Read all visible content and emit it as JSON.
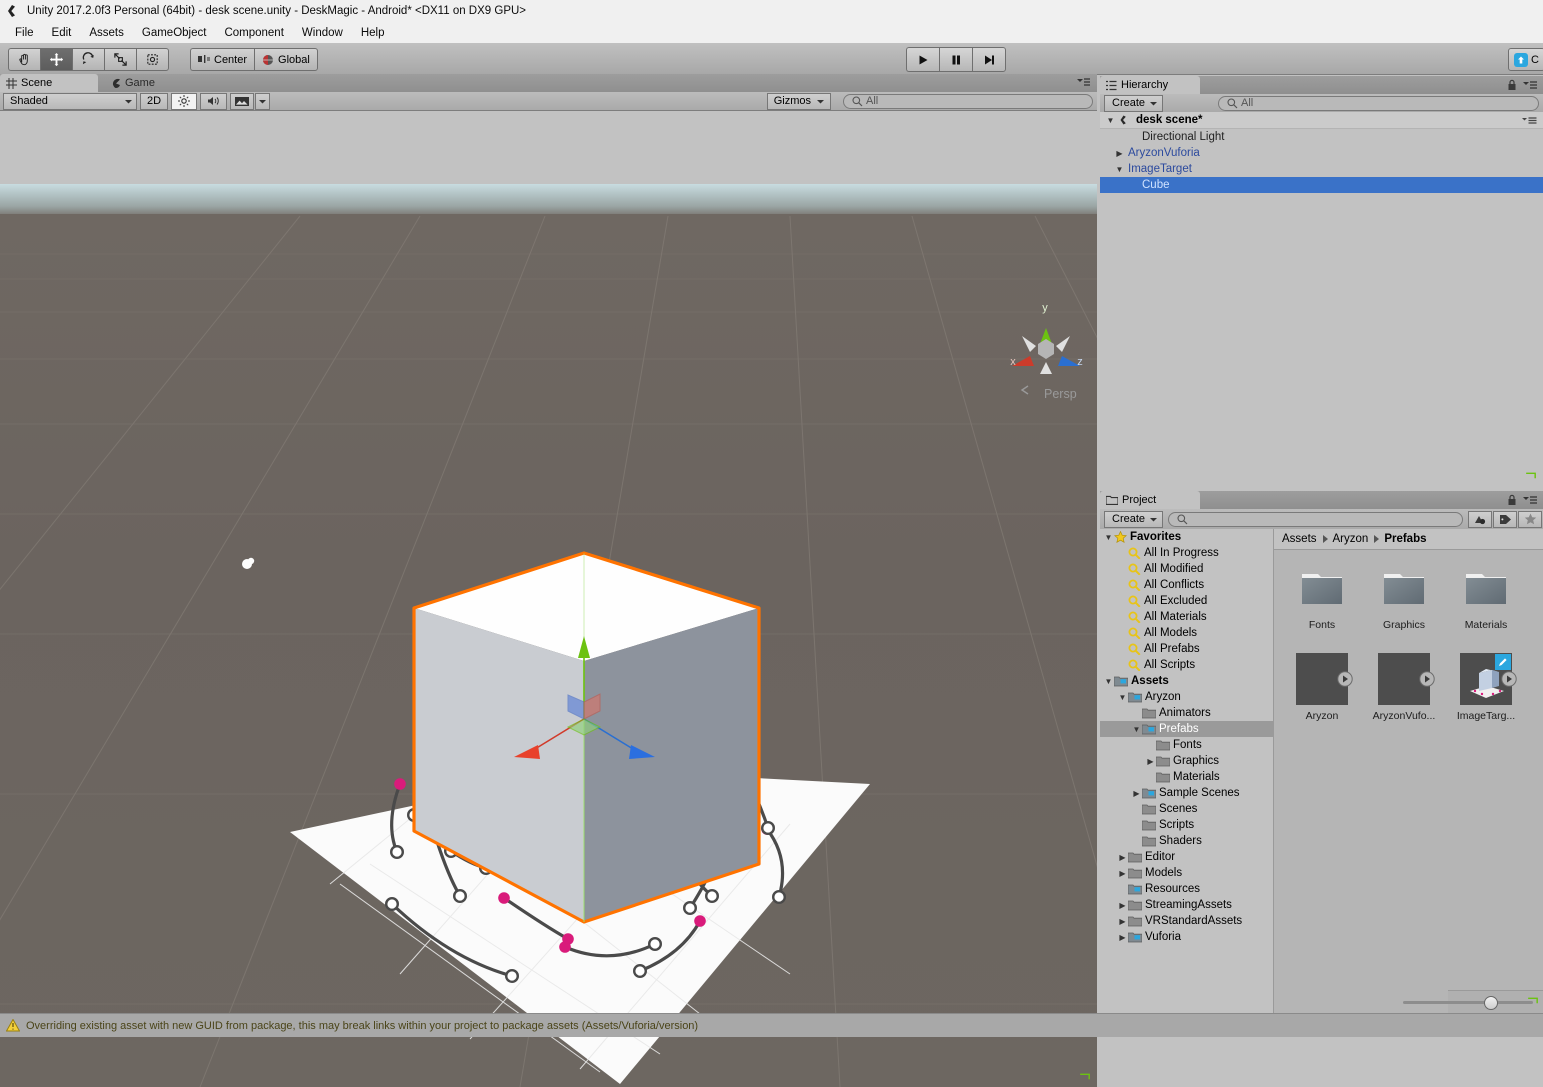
{
  "window": {
    "title": "Unity 2017.2.0f3 Personal (64bit) - desk scene.unity - DeskMagic - Android* <DX11 on DX9 GPU>",
    "logo_icon": "unity-logo-icon"
  },
  "menubar": {
    "items": [
      {
        "label": "File"
      },
      {
        "label": "Edit"
      },
      {
        "label": "Assets"
      },
      {
        "label": "GameObject"
      },
      {
        "label": "Component"
      },
      {
        "label": "Window"
      },
      {
        "label": "Help"
      }
    ]
  },
  "toolbar": {
    "tools": [
      {
        "name": "hand-tool",
        "icon": "hand-icon",
        "active": false
      },
      {
        "name": "move-tool",
        "icon": "move-arrows-icon",
        "active": true
      },
      {
        "name": "rotate-tool",
        "icon": "rotate-icon",
        "active": false
      },
      {
        "name": "scale-tool",
        "icon": "scale-icon",
        "active": false
      },
      {
        "name": "rect-tool",
        "icon": "rect-transform-icon",
        "active": false
      }
    ],
    "pivot_label": "Center",
    "pivot_icon": "pivot-center-icon",
    "space_label": "Global",
    "space_icon": "globe-icon",
    "play_label": "play-button",
    "pause_label": "pause-button",
    "step_label": "step-button",
    "collab_label": "C",
    "collab_icon": "cloud-up-icon"
  },
  "scene_panel": {
    "tabs": [
      {
        "label": "Scene",
        "icon": "grid-icon",
        "active": true
      },
      {
        "label": "Game",
        "icon": "gamepad-icon",
        "active": false
      }
    ],
    "draw_mode": "Shaded",
    "mode_2d": "2D",
    "lighting_icon": "sun-icon",
    "audio_icon": "speaker-icon",
    "effects_icon": "image-icon",
    "gizmos_label": "Gizmos",
    "search_placeholder": "All",
    "search_value": "",
    "gizmo": {
      "axis_y": "y",
      "axis_x": "x",
      "axis_z": "z",
      "projection": "Persp",
      "color_x": "#d13a2a",
      "color_y": "#6cc211",
      "color_z": "#2a6fd1"
    },
    "selection_outline_color": "#ff7300",
    "scene_objects": [
      "Cube",
      "ImageTarget plane",
      "Directional Light gizmo"
    ]
  },
  "hierarchy": {
    "tab_label": "Hierarchy",
    "tab_icon": "hierarchy-icon",
    "lock_icon": "lock-icon",
    "menu_icon": "panel-menu-icon",
    "create_label": "Create",
    "search_placeholder": "All",
    "search_value": "",
    "scene_name": "desk scene*",
    "scene_icon": "unity-scene-icon",
    "items": [
      {
        "label": "Directional Light",
        "indent": 2,
        "expander": "none",
        "prefab": false,
        "selected": false
      },
      {
        "label": "AryzonVuforia",
        "indent": 1,
        "expander": "collapsed",
        "prefab": true,
        "selected": false
      },
      {
        "label": "ImageTarget",
        "indent": 1,
        "expander": "expanded",
        "prefab": true,
        "selected": false
      },
      {
        "label": "Cube",
        "indent": 2,
        "expander": "none",
        "prefab": true,
        "selected": true
      }
    ]
  },
  "project": {
    "tab_label": "Project",
    "tab_icon": "folder-icon",
    "lock_icon": "lock-icon",
    "menu_icon": "panel-menu-icon",
    "create_label": "Create",
    "search_placeholder": "",
    "search_value": "",
    "filter_buttons": [
      {
        "name": "filter-by-type-button",
        "icon": "object-filter-icon"
      },
      {
        "name": "filter-by-label-button",
        "icon": "tag-icon"
      },
      {
        "name": "favorite-button",
        "icon": "star-icon"
      }
    ],
    "breadcrumb": [
      "Assets",
      "Aryzon",
      "Prefabs"
    ],
    "tree": [
      {
        "label": "Favorites",
        "indent": 0,
        "expander": "expanded",
        "icon": "star-icon",
        "bold": true,
        "selected": false
      },
      {
        "label": "All In Progress",
        "indent": 1,
        "expander": "none",
        "icon": "search-icon",
        "bold": false,
        "selected": false
      },
      {
        "label": "All Modified",
        "indent": 1,
        "expander": "none",
        "icon": "search-icon",
        "bold": false,
        "selected": false
      },
      {
        "label": "All Conflicts",
        "indent": 1,
        "expander": "none",
        "icon": "search-icon",
        "bold": false,
        "selected": false
      },
      {
        "label": "All Excluded",
        "indent": 1,
        "expander": "none",
        "icon": "search-icon",
        "bold": false,
        "selected": false
      },
      {
        "label": "All Materials",
        "indent": 1,
        "expander": "none",
        "icon": "search-icon",
        "bold": false,
        "selected": false
      },
      {
        "label": "All Models",
        "indent": 1,
        "expander": "none",
        "icon": "search-icon",
        "bold": false,
        "selected": false
      },
      {
        "label": "All Prefabs",
        "indent": 1,
        "expander": "none",
        "icon": "search-icon",
        "bold": false,
        "selected": false
      },
      {
        "label": "All Scripts",
        "indent": 1,
        "expander": "none",
        "icon": "search-icon",
        "bold": false,
        "selected": false
      },
      {
        "label": "Assets",
        "indent": 0,
        "expander": "expanded",
        "icon": "folder-blue-icon",
        "bold": true,
        "selected": false
      },
      {
        "label": "Aryzon",
        "indent": 1,
        "expander": "expanded",
        "icon": "folder-blue-icon",
        "bold": false,
        "selected": false
      },
      {
        "label": "Animators",
        "indent": 2,
        "expander": "none",
        "icon": "folder-icon",
        "bold": false,
        "selected": false
      },
      {
        "label": "Prefabs",
        "indent": 2,
        "expander": "expanded",
        "icon": "folder-blue-icon",
        "bold": false,
        "selected": true
      },
      {
        "label": "Fonts",
        "indent": 3,
        "expander": "none",
        "icon": "folder-icon",
        "bold": false,
        "selected": false
      },
      {
        "label": "Graphics",
        "indent": 3,
        "expander": "collapsed",
        "icon": "folder-icon",
        "bold": false,
        "selected": false
      },
      {
        "label": "Materials",
        "indent": 3,
        "expander": "none",
        "icon": "folder-icon",
        "bold": false,
        "selected": false
      },
      {
        "label": "Sample Scenes",
        "indent": 2,
        "expander": "collapsed",
        "icon": "folder-blue-icon",
        "bold": false,
        "selected": false
      },
      {
        "label": "Scenes",
        "indent": 2,
        "expander": "none",
        "icon": "folder-icon",
        "bold": false,
        "selected": false
      },
      {
        "label": "Scripts",
        "indent": 2,
        "expander": "none",
        "icon": "folder-icon",
        "bold": false,
        "selected": false
      },
      {
        "label": "Shaders",
        "indent": 2,
        "expander": "none",
        "icon": "folder-icon",
        "bold": false,
        "selected": false
      },
      {
        "label": "Editor",
        "indent": 1,
        "expander": "collapsed",
        "icon": "folder-icon",
        "bold": false,
        "selected": false
      },
      {
        "label": "Models",
        "indent": 1,
        "expander": "collapsed",
        "icon": "folder-icon",
        "bold": false,
        "selected": false
      },
      {
        "label": "Resources",
        "indent": 1,
        "expander": "none",
        "icon": "folder-blue-icon",
        "bold": false,
        "selected": false
      },
      {
        "label": "StreamingAssets",
        "indent": 1,
        "expander": "collapsed",
        "icon": "folder-icon",
        "bold": false,
        "selected": false
      },
      {
        "label": "VRStandardAssets",
        "indent": 1,
        "expander": "collapsed",
        "icon": "folder-icon",
        "bold": false,
        "selected": false
      },
      {
        "label": "Vuforia",
        "indent": 1,
        "expander": "collapsed",
        "icon": "folder-blue-icon",
        "bold": false,
        "selected": false
      }
    ],
    "assets": [
      {
        "label": "Fonts",
        "kind": "folder"
      },
      {
        "label": "Graphics",
        "kind": "folder"
      },
      {
        "label": "Materials",
        "kind": "folder"
      },
      {
        "label": "Aryzon",
        "kind": "prefab"
      },
      {
        "label": "AryzonVufo...",
        "kind": "prefab"
      },
      {
        "label": "ImageTarg...",
        "kind": "prefab-preview"
      }
    ]
  },
  "statusbar": {
    "icon": "warning-icon",
    "message": "Overriding existing asset with new GUID from package, this may break links within your project to package assets (Assets/Vuforia/version)"
  }
}
